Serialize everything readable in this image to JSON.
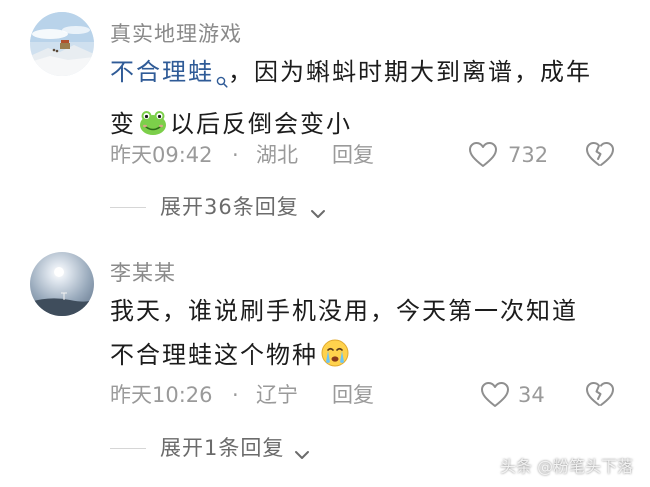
{
  "comments": [
    {
      "username": "真实地理游戏",
      "mention": "不合理蛙",
      "line1_rest": "，因为蝌蚪时期大到离谱，成年",
      "line2_start": "变",
      "line2_end": "以后反倒会变小",
      "time": "昨天09:42",
      "dot": "·",
      "location": "湖北",
      "reply": "回复",
      "likes": "732",
      "expand": "展开36条回复"
    },
    {
      "username": "李某某",
      "line1": "我天，谁说刷手机没用，今天第一次知道",
      "line2": "不合理蛙这个物种",
      "time": "昨天10:26",
      "dot": "·",
      "location": "辽宁",
      "reply": "回复",
      "likes": "34",
      "expand": "展开1条回复"
    }
  ],
  "watermark": "头条 @粉笔头下落",
  "icons": {
    "like": "heart-outline-icon",
    "dislike": "broken-heart-outline-icon",
    "expand": "chevron-down-icon",
    "mention": "search-icon"
  },
  "colors": {
    "mention": "#2f5b97",
    "meta": "#9a9a9a",
    "body": "#1c1c1c"
  }
}
